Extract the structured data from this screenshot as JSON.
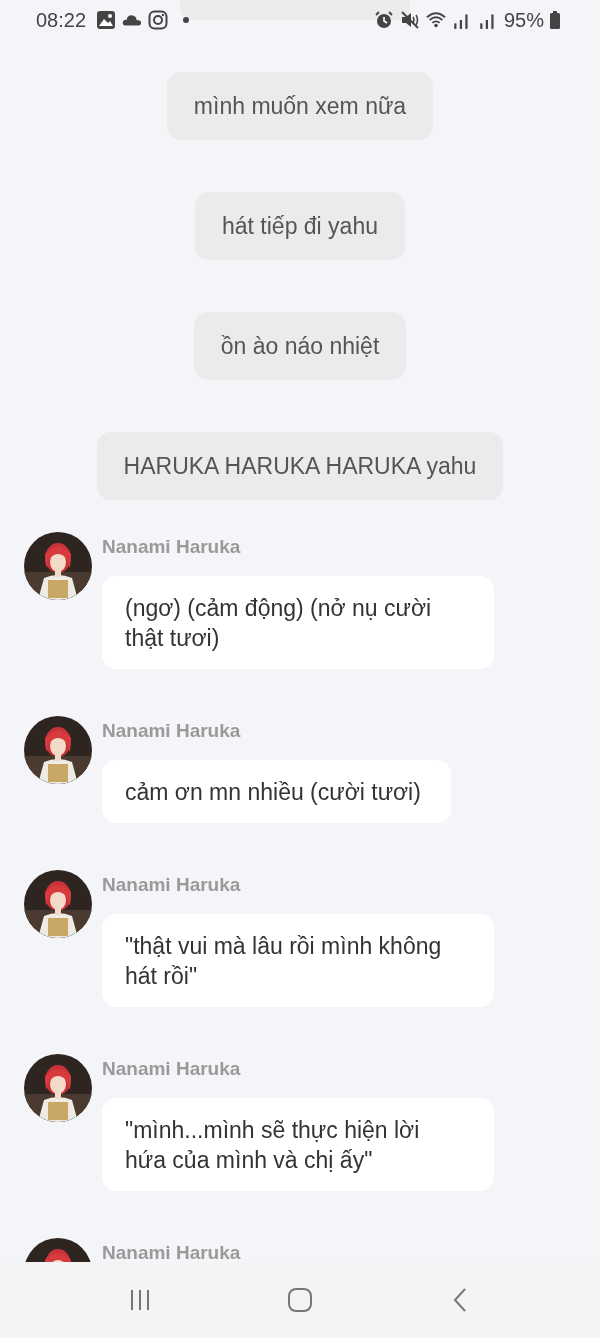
{
  "status_bar": {
    "time": "08:22",
    "battery": "95%"
  },
  "messages": [
    {
      "kind": "bubble",
      "text": "mình muốn xem nữa"
    },
    {
      "kind": "bubble",
      "text": "hát tiếp đi yahu"
    },
    {
      "kind": "bubble",
      "text": "ồn ào náo nhiệt"
    },
    {
      "kind": "bubble",
      "text": "HARUKA HARUKA HARUKA yahu"
    },
    {
      "kind": "character",
      "name": "Nanami Haruka",
      "text": "(ngơ) (cảm động) (nở nụ cười thật tươi)"
    },
    {
      "kind": "character",
      "name": "Nanami Haruka",
      "text": "cảm ơn mn nhiều (cười tươi)"
    },
    {
      "kind": "character",
      "name": "Nanami Haruka",
      "text": "\"thật vui mà lâu rồi mình không hát rồi\""
    },
    {
      "kind": "character",
      "name": "Nanami Haruka",
      "text": "\"mình...mình sẽ thực hiện lời hứa của mình và chị ấy\""
    },
    {
      "kind": "character",
      "name": "Nanami Haruka"
    }
  ]
}
